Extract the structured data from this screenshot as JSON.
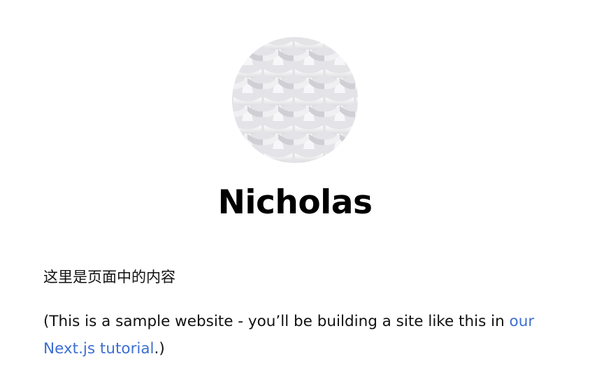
{
  "profile": {
    "name": "Nicholas",
    "avatar_icon": "woven-pattern-avatar"
  },
  "main": {
    "intro_text": "这里是页面中的内容",
    "note_prefix": "(This is a sample website - you’ll be building a site like this in ",
    "note_link": "our Next.js tutorial",
    "note_suffix": ".)"
  },
  "colors": {
    "link": "#3d6ed1",
    "text": "#111111",
    "avatar_bg": "#ececef"
  }
}
